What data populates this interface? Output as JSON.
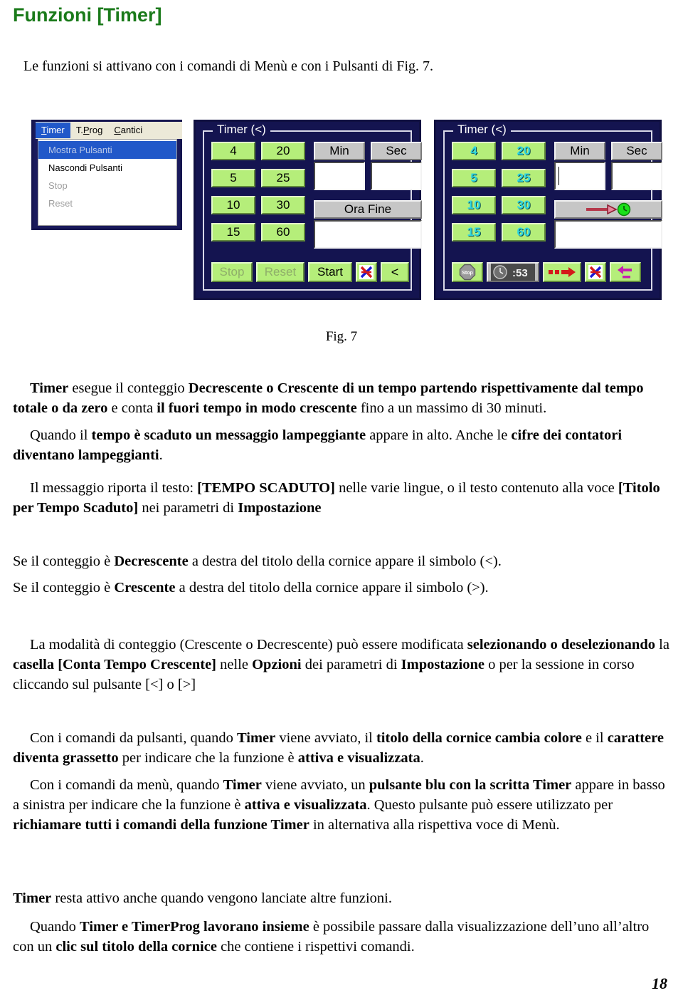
{
  "document": {
    "title": "Funzioni [Timer]",
    "intro": "Le funzioni si attivano con i comandi di Menù e con i Pulsanti di Fig. 7.",
    "figure_caption": "Fig. 7",
    "page_number": "18"
  },
  "figure": {
    "menu_panel": {
      "menubar": [
        {
          "label_pre": "",
          "mnemonic": "T",
          "label_post": "imer",
          "selected": true
        },
        {
          "label_pre": "T.",
          "mnemonic": "P",
          "label_post": "rog",
          "selected": false
        },
        {
          "label_pre": "",
          "mnemonic": "C",
          "label_post": "antici",
          "selected": false
        }
      ],
      "dropdown": [
        {
          "label": "Mostra Pulsanti",
          "state": "highlight"
        },
        {
          "label": "Nascondi Pulsanti",
          "state": "normal"
        },
        {
          "label": "Stop",
          "state": "disabled"
        },
        {
          "label": "Reset",
          "state": "disabled"
        }
      ]
    },
    "panel_left": {
      "group_title": "Timer (<)",
      "presets_col1": [
        "4",
        "5",
        "10",
        "15"
      ],
      "presets_col2": [
        "20",
        "25",
        "30",
        "60"
      ],
      "min_label": "Min",
      "sec_label": "Sec",
      "min_value": "",
      "sec_value": "",
      "ora_fine_label": "Ora Fine",
      "ora_fine_value": "",
      "actions": {
        "stop": "Stop",
        "reset": "Reset",
        "start": "Start",
        "cancel_icon": "cancel-x-icon",
        "decrement_symbol": "<"
      }
    },
    "panel_right": {
      "group_title": "Timer (<)",
      "presets_col1": [
        "4",
        "5",
        "10",
        "15"
      ],
      "presets_col2": [
        "20",
        "25",
        "30",
        "60"
      ],
      "min_label": "Min",
      "sec_label": "Sec",
      "min_value": "",
      "sec_value": "",
      "ora_fine_icon": "arrow-to-green-clock-icon",
      "ora_fine_value": "",
      "actions": {
        "stop_icon": "stop-octagon-icon",
        "clock_display": ":53",
        "forward_icon": "red-arrow-icon",
        "cancel_icon": "cancel-x-icon",
        "back_icon": "magenta-back-arrow-icon"
      }
    },
    "colors": {
      "panel_background": "#141450",
      "button_green": "#b5ee7a",
      "active_digit_cyan": "#2fd6e0",
      "menu_highlight_blue": "#2158c9",
      "menubar_background": "#ece9d8",
      "title_green": "#1a7a1a"
    }
  },
  "paragraphs": {
    "p1": {
      "runs": [
        {
          "t": "Timer",
          "b": true
        },
        {
          "t": " esegue il conteggio ",
          "b": false
        },
        {
          "t": "Decrescente o Crescente di un tempo partendo rispettivamente dal tempo totale o da zero",
          "b": true
        },
        {
          "t": " e conta ",
          "b": false
        },
        {
          "t": "il fuori tempo in modo crescente",
          "b": true
        },
        {
          "t": " fino a un massimo di 30 minuti.",
          "b": false
        }
      ]
    },
    "p2": {
      "runs": [
        {
          "t": "Quando il ",
          "b": false
        },
        {
          "t": "tempo è scaduto un messaggio lampeggiante",
          "b": true
        },
        {
          "t": " appare in alto. Anche le ",
          "b": false
        },
        {
          "t": "cifre dei contatori diventano lampeggianti",
          "b": true
        },
        {
          "t": ".",
          "b": false
        }
      ]
    },
    "p3": {
      "runs": [
        {
          "t": "Il messaggio riporta il testo: ",
          "b": false
        },
        {
          "t": "[TEMPO SCADUTO]",
          "b": true
        },
        {
          "t": " nelle varie lingue, o il testo contenuto alla voce ",
          "b": false
        },
        {
          "t": "[Titolo per Tempo Scaduto]",
          "b": true
        },
        {
          "t": " nei parametri di ",
          "b": false
        },
        {
          "t": "Impostazione",
          "b": true
        }
      ]
    },
    "p4": {
      "runs": [
        {
          "t": "Se il conteggio è ",
          "b": false
        },
        {
          "t": "Decrescente",
          "b": true
        },
        {
          "t": " a destra del titolo della cornice appare il simbolo (<).",
          "b": false
        }
      ]
    },
    "p5": {
      "runs": [
        {
          "t": "Se il conteggio è ",
          "b": false
        },
        {
          "t": "Crescente",
          "b": true
        },
        {
          "t": " a destra del titolo della cornice appare il simbolo (>).",
          "b": false
        }
      ]
    },
    "p6": {
      "runs": [
        {
          "t": "La modalità di conteggio (Crescente o Decrescente) può essere modificata ",
          "b": false
        },
        {
          "t": "selezionando o deselezionando",
          "b": true
        },
        {
          "t": " la ",
          "b": false
        },
        {
          "t": "casella [Conta Tempo Crescente]",
          "b": true
        },
        {
          "t": " nelle ",
          "b": false
        },
        {
          "t": "Opzioni",
          "b": true
        },
        {
          "t": " dei parametri di ",
          "b": false
        },
        {
          "t": "Impostazione",
          "b": true
        },
        {
          "t": " o per la sessione in corso cliccando sul pulsante [<] o [>]",
          "b": false
        }
      ]
    },
    "p7": {
      "runs": [
        {
          "t": "Con i comandi da pulsanti, quando ",
          "b": false
        },
        {
          "t": "Timer",
          "b": true
        },
        {
          "t": " viene avviato, il ",
          "b": false
        },
        {
          "t": "titolo della cornice cambia colore",
          "b": true
        },
        {
          "t": " e il ",
          "b": false
        },
        {
          "t": "carattere diventa grassetto",
          "b": true
        },
        {
          "t": " per indicare che la funzione è ",
          "b": false
        },
        {
          "t": "attiva e visualizzata",
          "b": true
        },
        {
          "t": ".",
          "b": false
        }
      ]
    },
    "p8": {
      "runs": [
        {
          "t": "Con i comandi da menù, quando ",
          "b": false
        },
        {
          "t": "Timer",
          "b": true
        },
        {
          "t": " viene avviato, un ",
          "b": false
        },
        {
          "t": "pulsante blu con la scritta Timer",
          "b": true
        },
        {
          "t": " appare in basso a sinistra per indicare che la funzione è ",
          "b": false
        },
        {
          "t": "attiva e visualizzata",
          "b": true
        },
        {
          "t": ". Questo pulsante può essere utilizzato per ",
          "b": false
        },
        {
          "t": "richiamare tutti i comandi della funzione Timer",
          "b": true
        },
        {
          "t": " in alternativa alla rispettiva voce di Menù.",
          "b": false
        }
      ]
    },
    "p9": {
      "runs": [
        {
          "t": "Timer",
          "b": true
        },
        {
          "t": " resta attivo anche quando vengono lanciate altre funzioni.",
          "b": false
        }
      ]
    },
    "p10": {
      "runs": [
        {
          "t": "Quando ",
          "b": false
        },
        {
          "t": "Timer e TimerProg lavorano insieme",
          "b": true
        },
        {
          "t": " è possibile passare dalla visualizzazione dell’uno all’altro con un ",
          "b": false
        },
        {
          "t": "clic sul titolo della cornice",
          "b": true
        },
        {
          "t": " che contiene i rispettivi comandi.",
          "b": false
        }
      ]
    }
  }
}
